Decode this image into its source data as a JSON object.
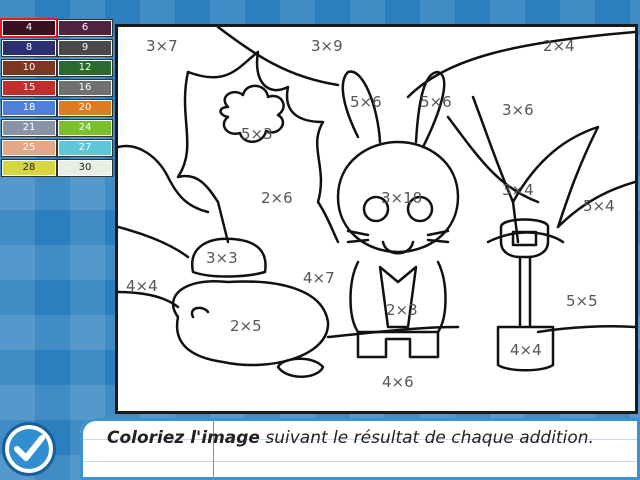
{
  "palette": [
    {
      "label": "4",
      "color": "#3a1020",
      "text": "#ffffff",
      "selected": true
    },
    {
      "label": "6",
      "color": "#4e2540",
      "text": "#ffffff"
    },
    {
      "label": "8",
      "color": "#2a2f72",
      "text": "#ffffff"
    },
    {
      "label": "9",
      "color": "#4a4a4a",
      "text": "#ffffff"
    },
    {
      "label": "10",
      "color": "#7a3820",
      "text": "#ffffff"
    },
    {
      "label": "12",
      "color": "#2c6a2f",
      "text": "#ffffff"
    },
    {
      "label": "15",
      "color": "#c02e2e",
      "text": "#ffffff"
    },
    {
      "label": "16",
      "color": "#707070",
      "text": "#ffffff"
    },
    {
      "label": "18",
      "color": "#4f7fd6",
      "text": "#ffffff"
    },
    {
      "label": "20",
      "color": "#dd7a22",
      "text": "#ffffff"
    },
    {
      "label": "21",
      "color": "#8a94a8",
      "text": "#ffffff"
    },
    {
      "label": "24",
      "color": "#7cbf2e",
      "text": "#ffffff"
    },
    {
      "label": "25",
      "color": "#e3a88a",
      "text": "#ffffff"
    },
    {
      "label": "27",
      "color": "#5fc6d8",
      "text": "#ffffff"
    },
    {
      "label": "28",
      "color": "#d8d640",
      "text": "#222222"
    },
    {
      "label": "30",
      "color": "#e6efe2",
      "text": "#222222"
    }
  ],
  "regions": [
    {
      "id": "r1",
      "label": "3×7"
    },
    {
      "id": "r2",
      "label": "3×9"
    },
    {
      "id": "r3",
      "label": "2×4"
    },
    {
      "id": "r4",
      "label": "5×6"
    },
    {
      "id": "r5",
      "label": "5×6"
    },
    {
      "id": "r6",
      "label": "3×6"
    },
    {
      "id": "r7",
      "label": "5×3"
    },
    {
      "id": "r8",
      "label": "3×10"
    },
    {
      "id": "r9",
      "label": "3×4"
    },
    {
      "id": "r10",
      "label": "2×6"
    },
    {
      "id": "r11",
      "label": "5×4"
    },
    {
      "id": "r12",
      "label": "3×3"
    },
    {
      "id": "r13",
      "label": "4×7"
    },
    {
      "id": "r14",
      "label": "4×4"
    },
    {
      "id": "r15",
      "label": "2×3"
    },
    {
      "id": "r16",
      "label": "5×5"
    },
    {
      "id": "r17",
      "label": "2×5"
    },
    {
      "id": "r18",
      "label": "4×4"
    },
    {
      "id": "r19",
      "label": "4×6"
    }
  ],
  "instruction": {
    "bold": "Coloriez l'image",
    "rest": " suivant le résultat de chaque addition."
  }
}
